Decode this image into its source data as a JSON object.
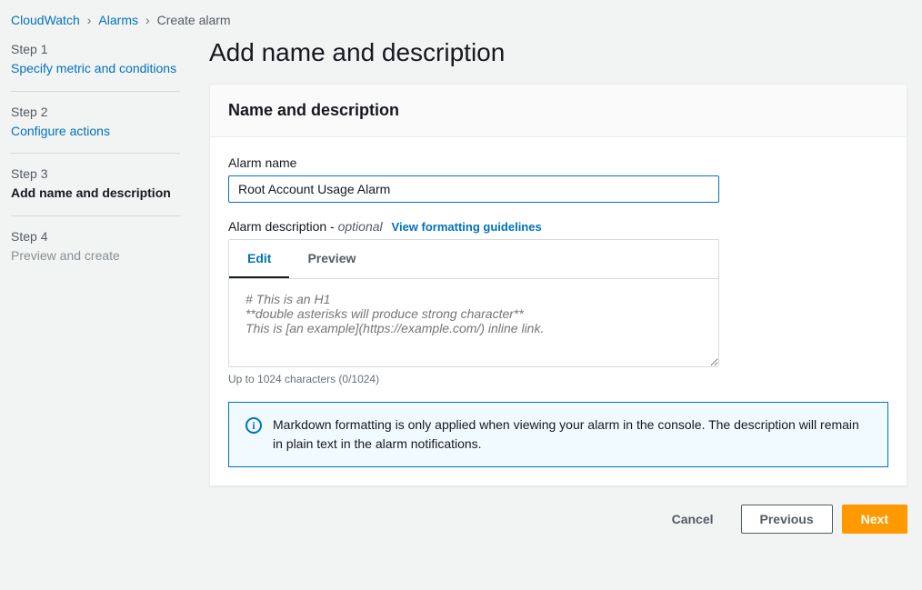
{
  "breadcrumb": {
    "item1": "CloudWatch",
    "item2": "Alarms",
    "item3": "Create alarm"
  },
  "sidebar": {
    "step1_num": "Step 1",
    "step1_title": "Specify metric and conditions",
    "step2_num": "Step 2",
    "step2_title": "Configure actions",
    "step3_num": "Step 3",
    "step3_title": "Add name and description",
    "step4_num": "Step 4",
    "step4_title": "Preview and create"
  },
  "page_title": "Add name and description",
  "panel_title": "Name and description",
  "alarm_name_label": "Alarm name",
  "alarm_name_value": "Root Account Usage Alarm",
  "alarm_desc_label": "Alarm description - ",
  "alarm_desc_optional": "optional",
  "guidelines_link": "View formatting guidelines",
  "tabs": {
    "edit": "Edit",
    "preview": "Preview"
  },
  "desc_placeholder": "# This is an H1\n**double asterisks will produce strong character**\nThis is [an example](https://example.com/) inline link.",
  "char_hint": "Up to 1024 characters (0/1024)",
  "info_text": "Markdown formatting is only applied when viewing your alarm in the console. The description will remain in plain text in the alarm notifications.",
  "buttons": {
    "cancel": "Cancel",
    "previous": "Previous",
    "next": "Next"
  }
}
